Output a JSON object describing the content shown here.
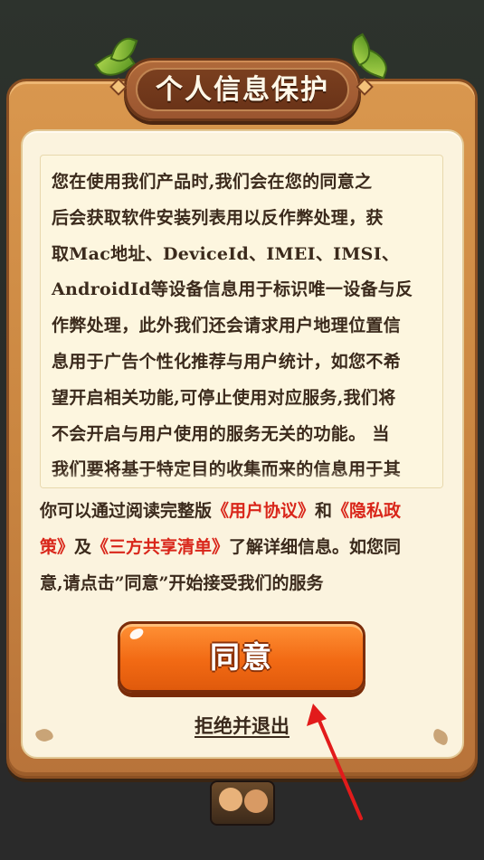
{
  "dialog": {
    "title": "个人信息保护",
    "policy_lines": [
      "您在使用我们产品时,我们会在您的同意之",
      "后会获取软件安装列表用以反作弊处理，获",
      "取Mac地址、DeviceId、IMEI、IMSI、",
      "AndroidId等设备信息用于标识唯一设备与反",
      "作弊处理，此外我们还会请求用户地理位置信",
      "息用于广告个性化推荐与用户统计，如您不希",
      "望开启相关功能,可停止使用对应服务,我们将",
      "不会开启与用户使用的服务无关的功能。 当",
      "我们要将基于特定目的收集而来的信息用于其"
    ],
    "consent": {
      "part1": "你可以通过阅读完整版",
      "user_agreement_link": "《用户协议》",
      "part2": "和",
      "privacy_link_a": "《隐私政",
      "privacy_link_b": "策》",
      "part3": "及",
      "sharing_list_link": "《三方共享清单》",
      "part4": "了解详细信息。如您同",
      "part5": "意,请点击”同意”开始接受我们的服务"
    },
    "agree_label": "同意",
    "reject_label": "拒绝并退出"
  },
  "colors": {
    "frame_wood": "#c98540",
    "panel_cream": "#fbf3de",
    "link_red": "#d9261a",
    "button_orange": "#f26a14",
    "annotation_arrow": "#e21b1b"
  },
  "icons": {
    "leaves": "leaf-icon",
    "gems": "diamond-gem-icon",
    "arrow": "red-arrow-annotation"
  }
}
